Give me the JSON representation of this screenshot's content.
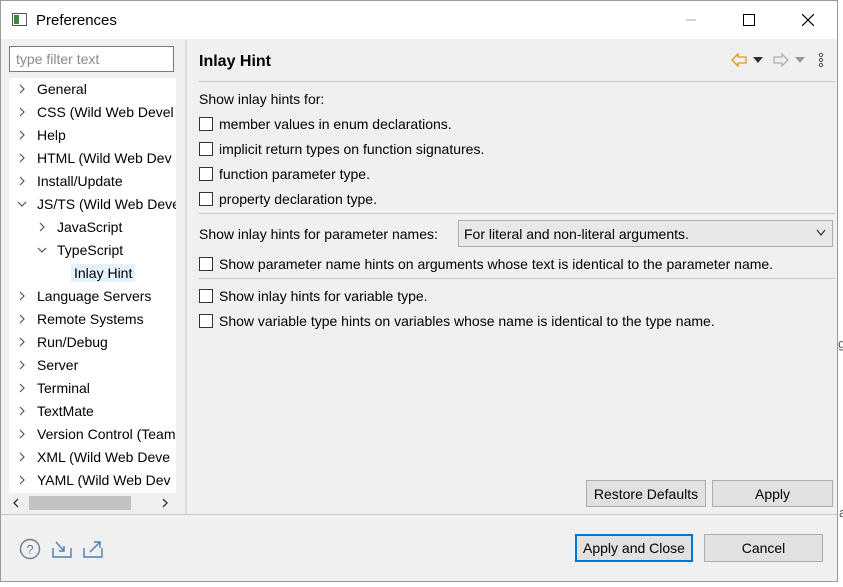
{
  "window": {
    "title": "Preferences"
  },
  "filter": {
    "placeholder": "type filter text"
  },
  "tree": [
    {
      "label": "General",
      "expanded": false
    },
    {
      "label": "CSS (Wild Web Devel",
      "expanded": false
    },
    {
      "label": "Help",
      "expanded": false
    },
    {
      "label": "HTML (Wild Web Dev",
      "expanded": false
    },
    {
      "label": "Install/Update",
      "expanded": false
    },
    {
      "label": "JS/TS (Wild Web Deve",
      "expanded": true
    },
    {
      "label": "JavaScript",
      "expanded": false
    },
    {
      "label": "TypeScript",
      "expanded": true
    },
    {
      "label": "Inlay Hint",
      "selected": true
    },
    {
      "label": "Language Servers",
      "expanded": false
    },
    {
      "label": "Remote Systems",
      "expanded": false
    },
    {
      "label": "Run/Debug",
      "expanded": false
    },
    {
      "label": "Server",
      "expanded": false
    },
    {
      "label": "Terminal",
      "expanded": false
    },
    {
      "label": "TextMate",
      "expanded": false
    },
    {
      "label": "Version Control (Team",
      "expanded": false
    },
    {
      "label": "XML (Wild Web Deve",
      "expanded": false
    },
    {
      "label": "YAML (Wild Web Dev",
      "expanded": false
    }
  ],
  "page": {
    "title": "Inlay Hint",
    "show_for_label": "Show inlay hints for:",
    "options": [
      {
        "label": "member values in enum declarations.",
        "checked": false
      },
      {
        "label": "implicit return types on function signatures.",
        "checked": false
      },
      {
        "label": "function parameter type.",
        "checked": false
      },
      {
        "label": "property declaration type.",
        "checked": false
      }
    ],
    "param_names_label": "Show inlay hints for parameter names:",
    "param_names_value": "For literal and non-literal arguments.",
    "param_identical_label": "Show parameter name hints on arguments whose text is identical to the parameter name.",
    "variable_type_label": "Show inlay hints for variable type.",
    "variable_identical_label": "Show variable type hints on variables whose name is identical to the type name.",
    "restore_defaults": "Restore Defaults",
    "apply": "Apply"
  },
  "footer": {
    "apply_close": "Apply and Close",
    "cancel": "Cancel"
  },
  "colors": {
    "accent": "#0078d7",
    "selection": "#e5f1fb",
    "nav_arrow": "#d4a017"
  }
}
